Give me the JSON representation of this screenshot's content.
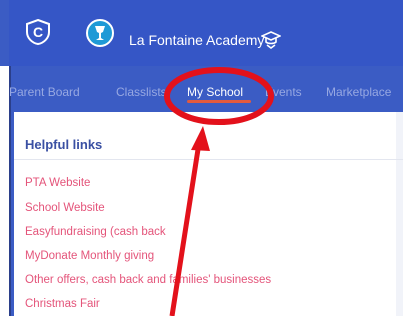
{
  "header": {
    "app_logo_letter": "C",
    "school_name": "La Fontaine Academy",
    "brand_color": "#3556c6"
  },
  "nav": {
    "items": [
      {
        "label": "Parent Board",
        "active": false
      },
      {
        "label": "Classlists",
        "active": false
      },
      {
        "label": "My School",
        "active": true
      },
      {
        "label": "Events",
        "active": false
      },
      {
        "label": "Marketplace",
        "active": false
      }
    ]
  },
  "panel": {
    "title": "Helpful links",
    "links": [
      "PTA Website",
      "School Website",
      "Easyfundraising (cash back",
      "MyDonate Monthly giving",
      "Other offers, cash back and families' businesses",
      "Christmas Fair"
    ],
    "link_color": "#e4547a"
  },
  "annotation": {
    "color": "#e3111b"
  }
}
